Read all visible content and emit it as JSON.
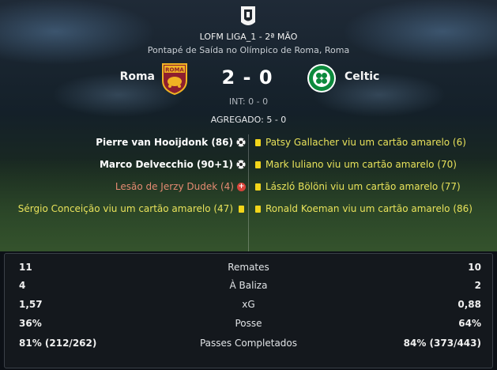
{
  "competition": {
    "title": "LOFM LIGA_1 - 2ª MÃO",
    "venue": "Pontapé de Saída no Olímpico de Roma, Roma",
    "logo_icon": "competition-trophy-icon"
  },
  "match": {
    "home": {
      "name": "Roma",
      "badge": "roma-crest-icon",
      "badge_text": "ROMA",
      "color": "#8e1f2f"
    },
    "away": {
      "name": "Celtic",
      "badge": "celtic-crest-icon",
      "color": "#0d8a3c"
    },
    "score": "2 - 0",
    "half_time": "INT: 0 - 0",
    "aggregate": "AGREGADO: 5 - 0"
  },
  "events": {
    "home": [
      {
        "text": "Pierre van Hooijdonk (86)",
        "kind": "goal",
        "icon": "goal-ball-icon"
      },
      {
        "text": "Marco Delvecchio (90+1)",
        "kind": "goal",
        "icon": "goal-ball-icon"
      },
      {
        "text": "Lesão de Jerzy Dudek (4)",
        "kind": "injury",
        "icon": "injury-cross-icon",
        "icon_glyph": "+"
      },
      {
        "text": "Sérgio Conceição viu um cartão amarelo (47)",
        "kind": "yellow",
        "icon": "yellow-card-icon"
      }
    ],
    "away": [
      {
        "text": "Patsy Gallacher viu um cartão amarelo (6)",
        "kind": "yellow",
        "icon": "yellow-card-icon"
      },
      {
        "text": "Mark Iuliano viu um cartão amarelo (70)",
        "kind": "yellow",
        "icon": "yellow-card-icon"
      },
      {
        "text": "László Bölöni viu um cartão amarelo (77)",
        "kind": "yellow",
        "icon": "yellow-card-icon"
      },
      {
        "text": "Ronald Koeman viu um cartão amarelo (86)",
        "kind": "yellow",
        "icon": "yellow-card-icon"
      }
    ]
  },
  "stats": [
    {
      "home": "11",
      "label": "Remates",
      "away": "10"
    },
    {
      "home": "4",
      "label": "À Baliza",
      "away": "2"
    },
    {
      "home": "1,57",
      "label": "xG",
      "away": "0,88"
    },
    {
      "home": "36%",
      "label": "Posse",
      "away": "64%"
    },
    {
      "home": "81% (212/262)",
      "label": "Passes Completados",
      "away": "84% (373/443)"
    }
  ]
}
